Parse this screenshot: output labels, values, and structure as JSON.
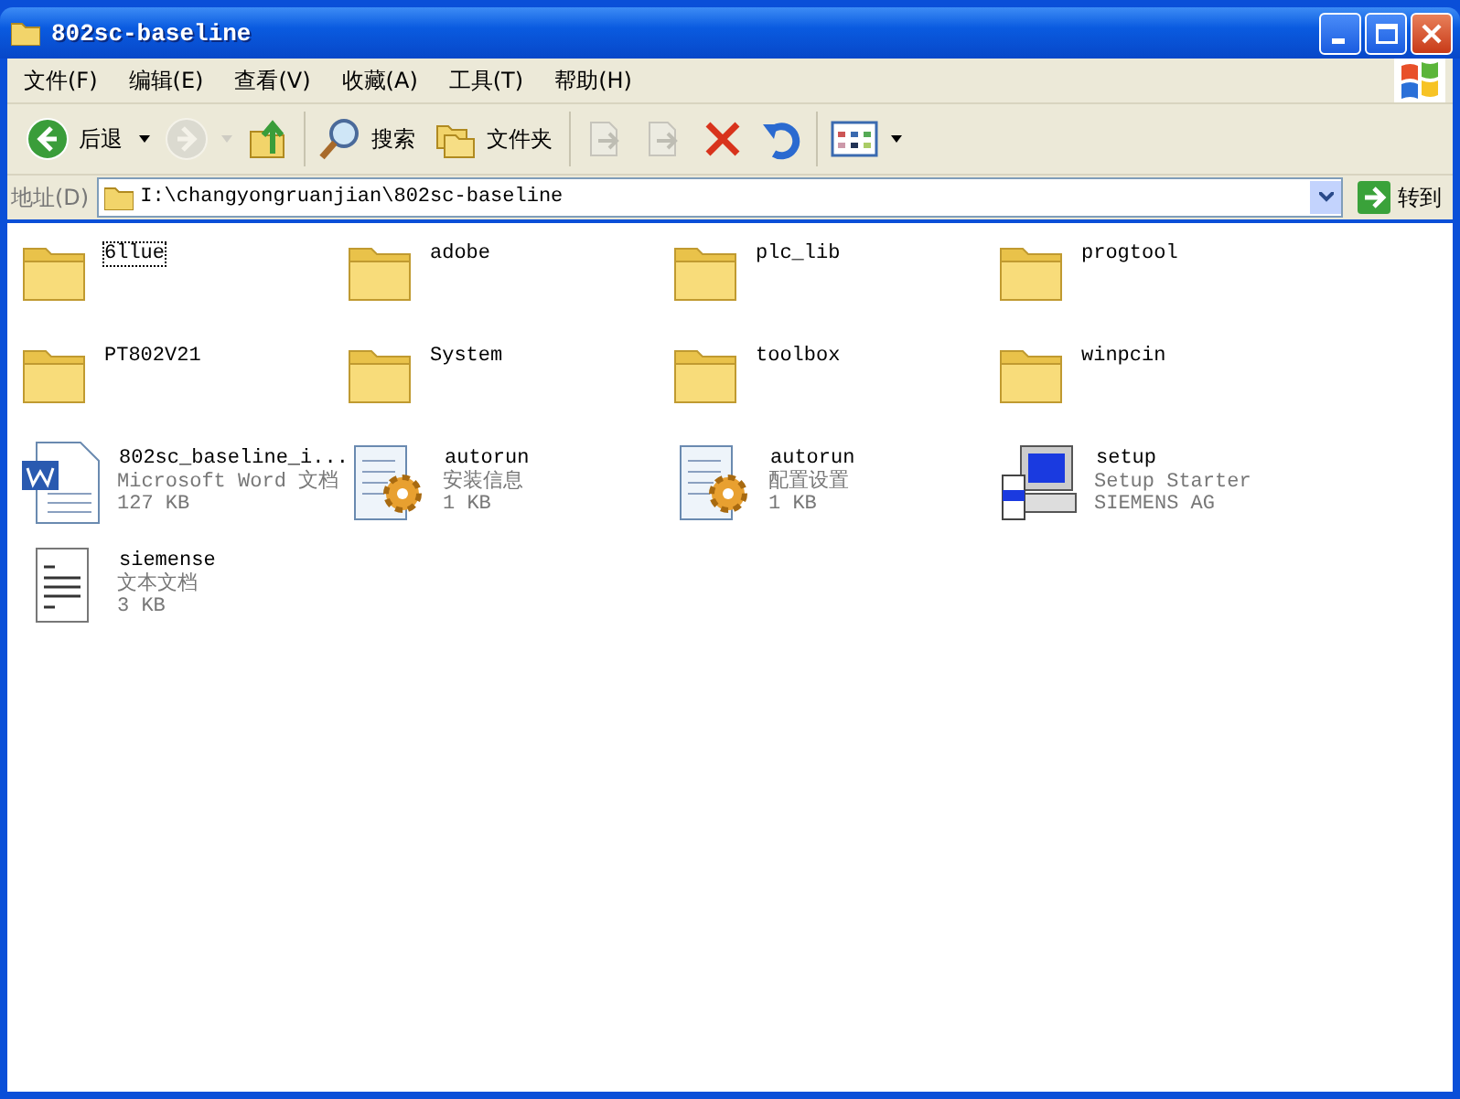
{
  "window": {
    "title": "802sc-baseline"
  },
  "menu": [
    {
      "label": "文件(F)"
    },
    {
      "label": "编辑(E)"
    },
    {
      "label": "查看(V)"
    },
    {
      "label": "收藏(A)"
    },
    {
      "label": "工具(T)"
    },
    {
      "label": "帮助(H)"
    }
  ],
  "toolbar": [
    {
      "kind": "back",
      "label": "后退",
      "disabled": false,
      "dropdown": true
    },
    {
      "kind": "forward",
      "disabled": true,
      "dropdown": true
    },
    {
      "kind": "up",
      "disabled": false
    },
    {
      "kind": "separator"
    },
    {
      "kind": "search",
      "label": "搜索",
      "disabled": false
    },
    {
      "kind": "folders",
      "label": "文件夹",
      "disabled": false
    },
    {
      "kind": "separator"
    },
    {
      "kind": "move",
      "disabled": true
    },
    {
      "kind": "copy",
      "disabled": true
    },
    {
      "kind": "delete",
      "disabled": false
    },
    {
      "kind": "undo",
      "disabled": false
    },
    {
      "kind": "separator"
    },
    {
      "kind": "views",
      "disabled": false,
      "dropdown": true
    }
  ],
  "address": {
    "label": "地址(D)",
    "value": "I:\\changyongruanjian\\802sc-baseline",
    "go": "转到"
  },
  "files": [
    {
      "kind": "folder",
      "name": "6llue",
      "focused": true
    },
    {
      "kind": "folder",
      "name": "adobe",
      "focused": false
    },
    {
      "kind": "folder",
      "name": "plc_lib",
      "focused": false
    },
    {
      "kind": "folder",
      "name": "progtool",
      "focused": false
    },
    {
      "kind": "folder",
      "name": "PT802V21",
      "focused": false
    },
    {
      "kind": "folder",
      "name": "System",
      "focused": false
    },
    {
      "kind": "folder",
      "name": "toolbox",
      "focused": false
    },
    {
      "kind": "folder",
      "name": "winpcin",
      "focused": false
    },
    {
      "kind": "word",
      "name": "802sc_baseline_i...",
      "details": [
        "Microsoft Word 文档",
        "127 KB"
      ],
      "focused": false
    },
    {
      "kind": "settings",
      "name": "autorun",
      "details": [
        "安装信息",
        "1 KB"
      ],
      "focused": false
    },
    {
      "kind": "settings",
      "name": "autorun",
      "details": [
        "配置设置",
        "1 KB"
      ],
      "focused": false
    },
    {
      "kind": "setup",
      "name": "setup",
      "details": [
        "Setup Starter",
        "SIEMENS AG"
      ],
      "focused": false
    },
    {
      "kind": "text",
      "name": "siemense",
      "details": [
        "文本文档",
        "3 KB"
      ],
      "focused": false
    }
  ]
}
